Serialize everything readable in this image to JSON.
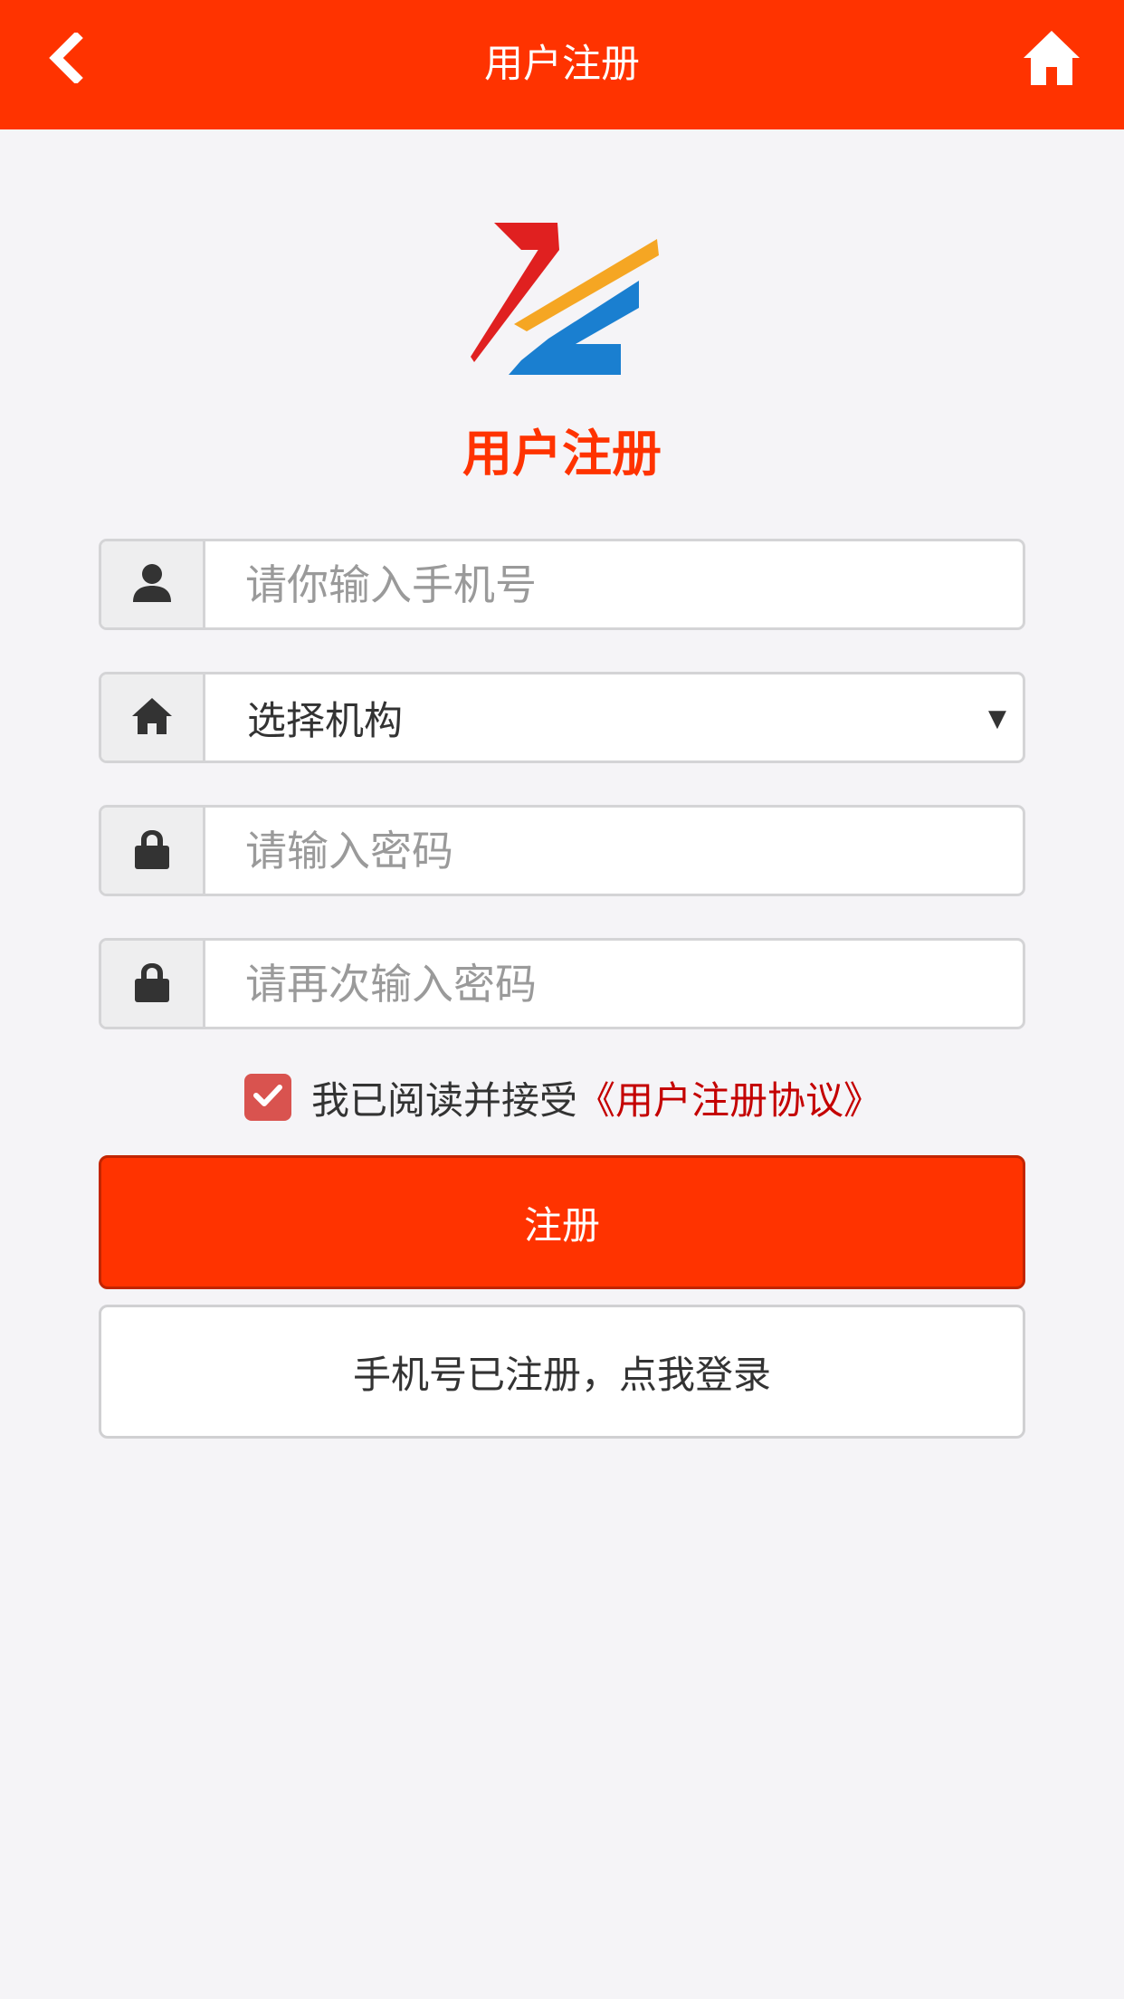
{
  "header": {
    "title": "用户注册",
    "back_icon": "chevron-left-icon",
    "home_icon": "home-icon",
    "background": "#ff3300"
  },
  "logo": {
    "alt": "ZZ logo",
    "colors": [
      "#e02020",
      "#f5a623",
      "#1a7fd0"
    ]
  },
  "page_heading": "用户注册",
  "form": {
    "phone": {
      "placeholder": "请你输入手机号",
      "value": "",
      "icon": "user-icon"
    },
    "organization": {
      "selected": "选择机构",
      "icon": "home-icon"
    },
    "password": {
      "placeholder": "请输入密码",
      "value": "",
      "icon": "lock-icon"
    },
    "password_confirm": {
      "placeholder": "请再次输入密码",
      "value": "",
      "icon": "lock-icon"
    }
  },
  "agreement": {
    "checked": true,
    "text": "我已阅读并接受",
    "link_text": "《用户注册协议》"
  },
  "buttons": {
    "register": "注册",
    "login": "手机号已注册，点我登录"
  },
  "colors": {
    "accent": "#ff3300",
    "link": "#c40000",
    "checkbox": "#d9534f"
  }
}
